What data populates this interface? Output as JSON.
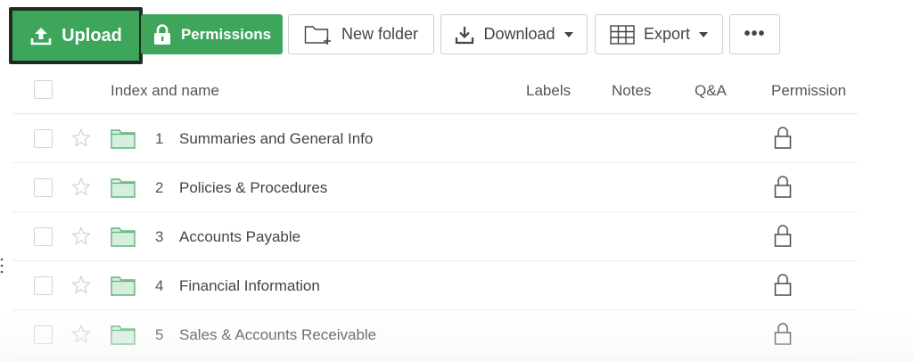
{
  "toolbar": {
    "upload_label": "Upload",
    "permissions_label": "Permissions",
    "new_folder_label": "New folder",
    "download_label": "Download",
    "export_label": "Export",
    "more_label": "•••"
  },
  "table": {
    "headers": {
      "name": "Index and name",
      "labels": "Labels",
      "notes": "Notes",
      "qa": "Q&A",
      "permission": "Permission"
    },
    "rows": [
      {
        "index": "1",
        "name": "Summaries and General Info"
      },
      {
        "index": "2",
        "name": "Policies & Procedures"
      },
      {
        "index": "3",
        "name": "Accounts Payable"
      },
      {
        "index": "4",
        "name": "Financial Information"
      },
      {
        "index": "5",
        "name": "Sales & Accounts Receivable"
      }
    ]
  },
  "colors": {
    "primary_green": "#3da65b",
    "upload_border": "#1f2a22",
    "folder_fill": "#d6eede",
    "folder_stroke": "#5db57c"
  },
  "icons": {
    "upload": "upload-icon",
    "permissions": "lock-icon",
    "new_folder": "folder-plus-icon",
    "download": "download-icon",
    "export": "table-grid-icon",
    "more": "ellipsis-icon",
    "row_star": "star-icon",
    "row_folder": "folder-icon",
    "row_permission": "lock-icon"
  }
}
